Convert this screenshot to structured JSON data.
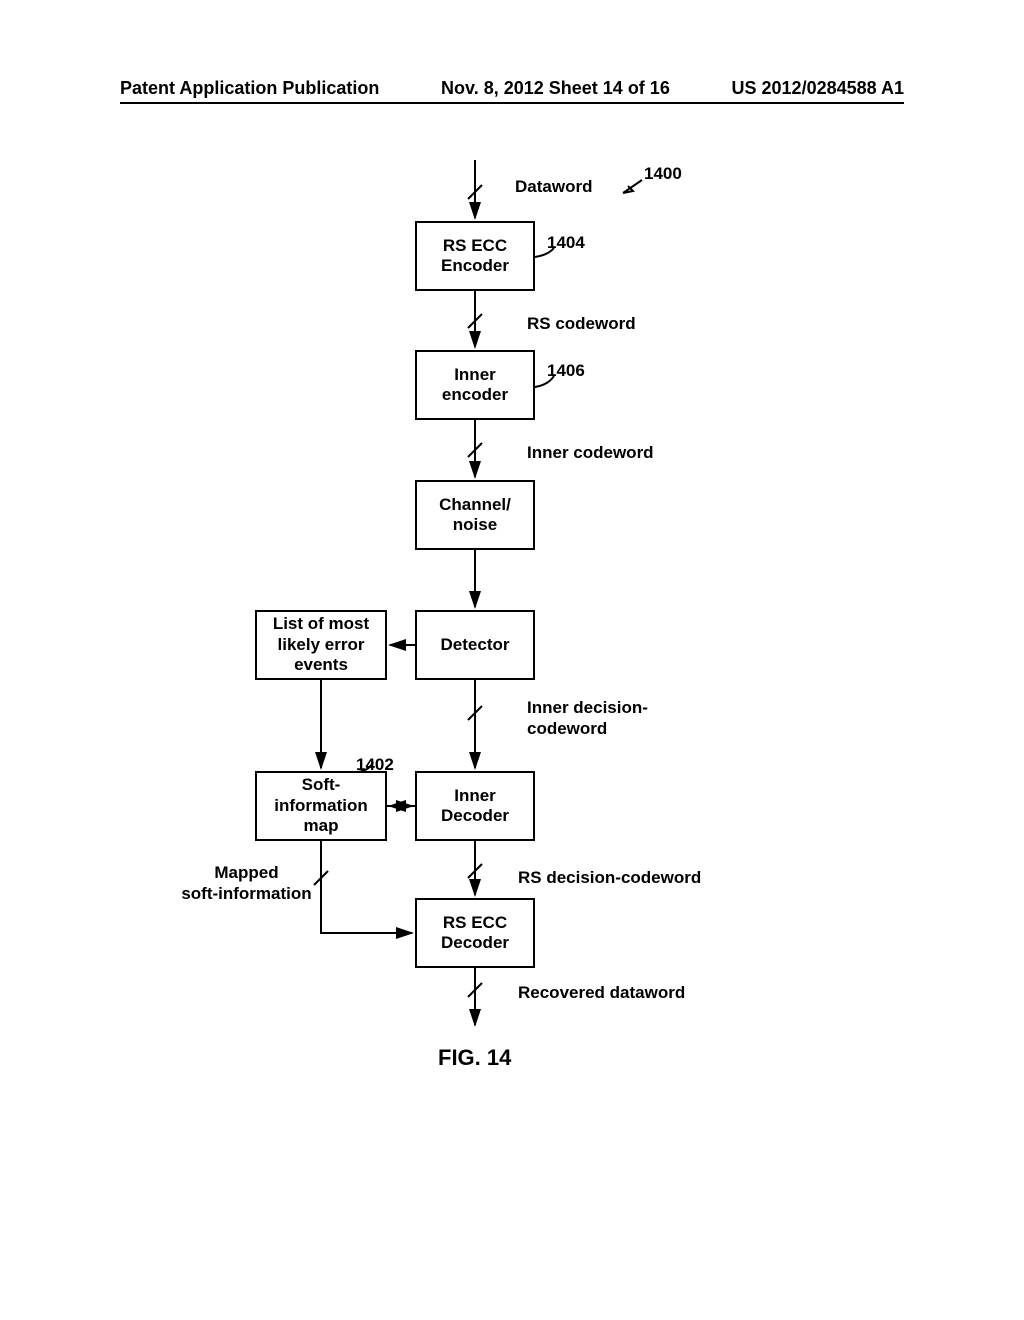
{
  "header": {
    "left": "Patent Application Publication",
    "center": "Nov. 8, 2012  Sheet 14 of 16",
    "right": "US 2012/0284588 A1"
  },
  "labels": {
    "dataword": "Dataword",
    "ref_1400": "1400",
    "ref_1404": "1404",
    "ref_1406": "1406",
    "ref_1402": "1402",
    "rs_codeword": "RS codeword",
    "inner_codeword": "Inner codeword",
    "inner_decision_codeword": "Inner decision-\ncodeword",
    "rs_decision_codeword": "RS decision-codeword",
    "mapped_soft_info": "Mapped\nsoft-information",
    "recovered_dataword": "Recovered dataword"
  },
  "boxes": {
    "rs_ecc_encoder": "RS ECC\nEncoder",
    "inner_encoder": "Inner\nencoder",
    "channel_noise": "Channel/\nnoise",
    "detector": "Detector",
    "list_error_events": "List of most\nlikely error\nevents",
    "inner_decoder": "Inner\nDecoder",
    "soft_info_map": "Soft-\ninformation\nmap",
    "rs_ecc_decoder": "RS ECC\nDecoder"
  },
  "figure_caption": "FIG. 14"
}
